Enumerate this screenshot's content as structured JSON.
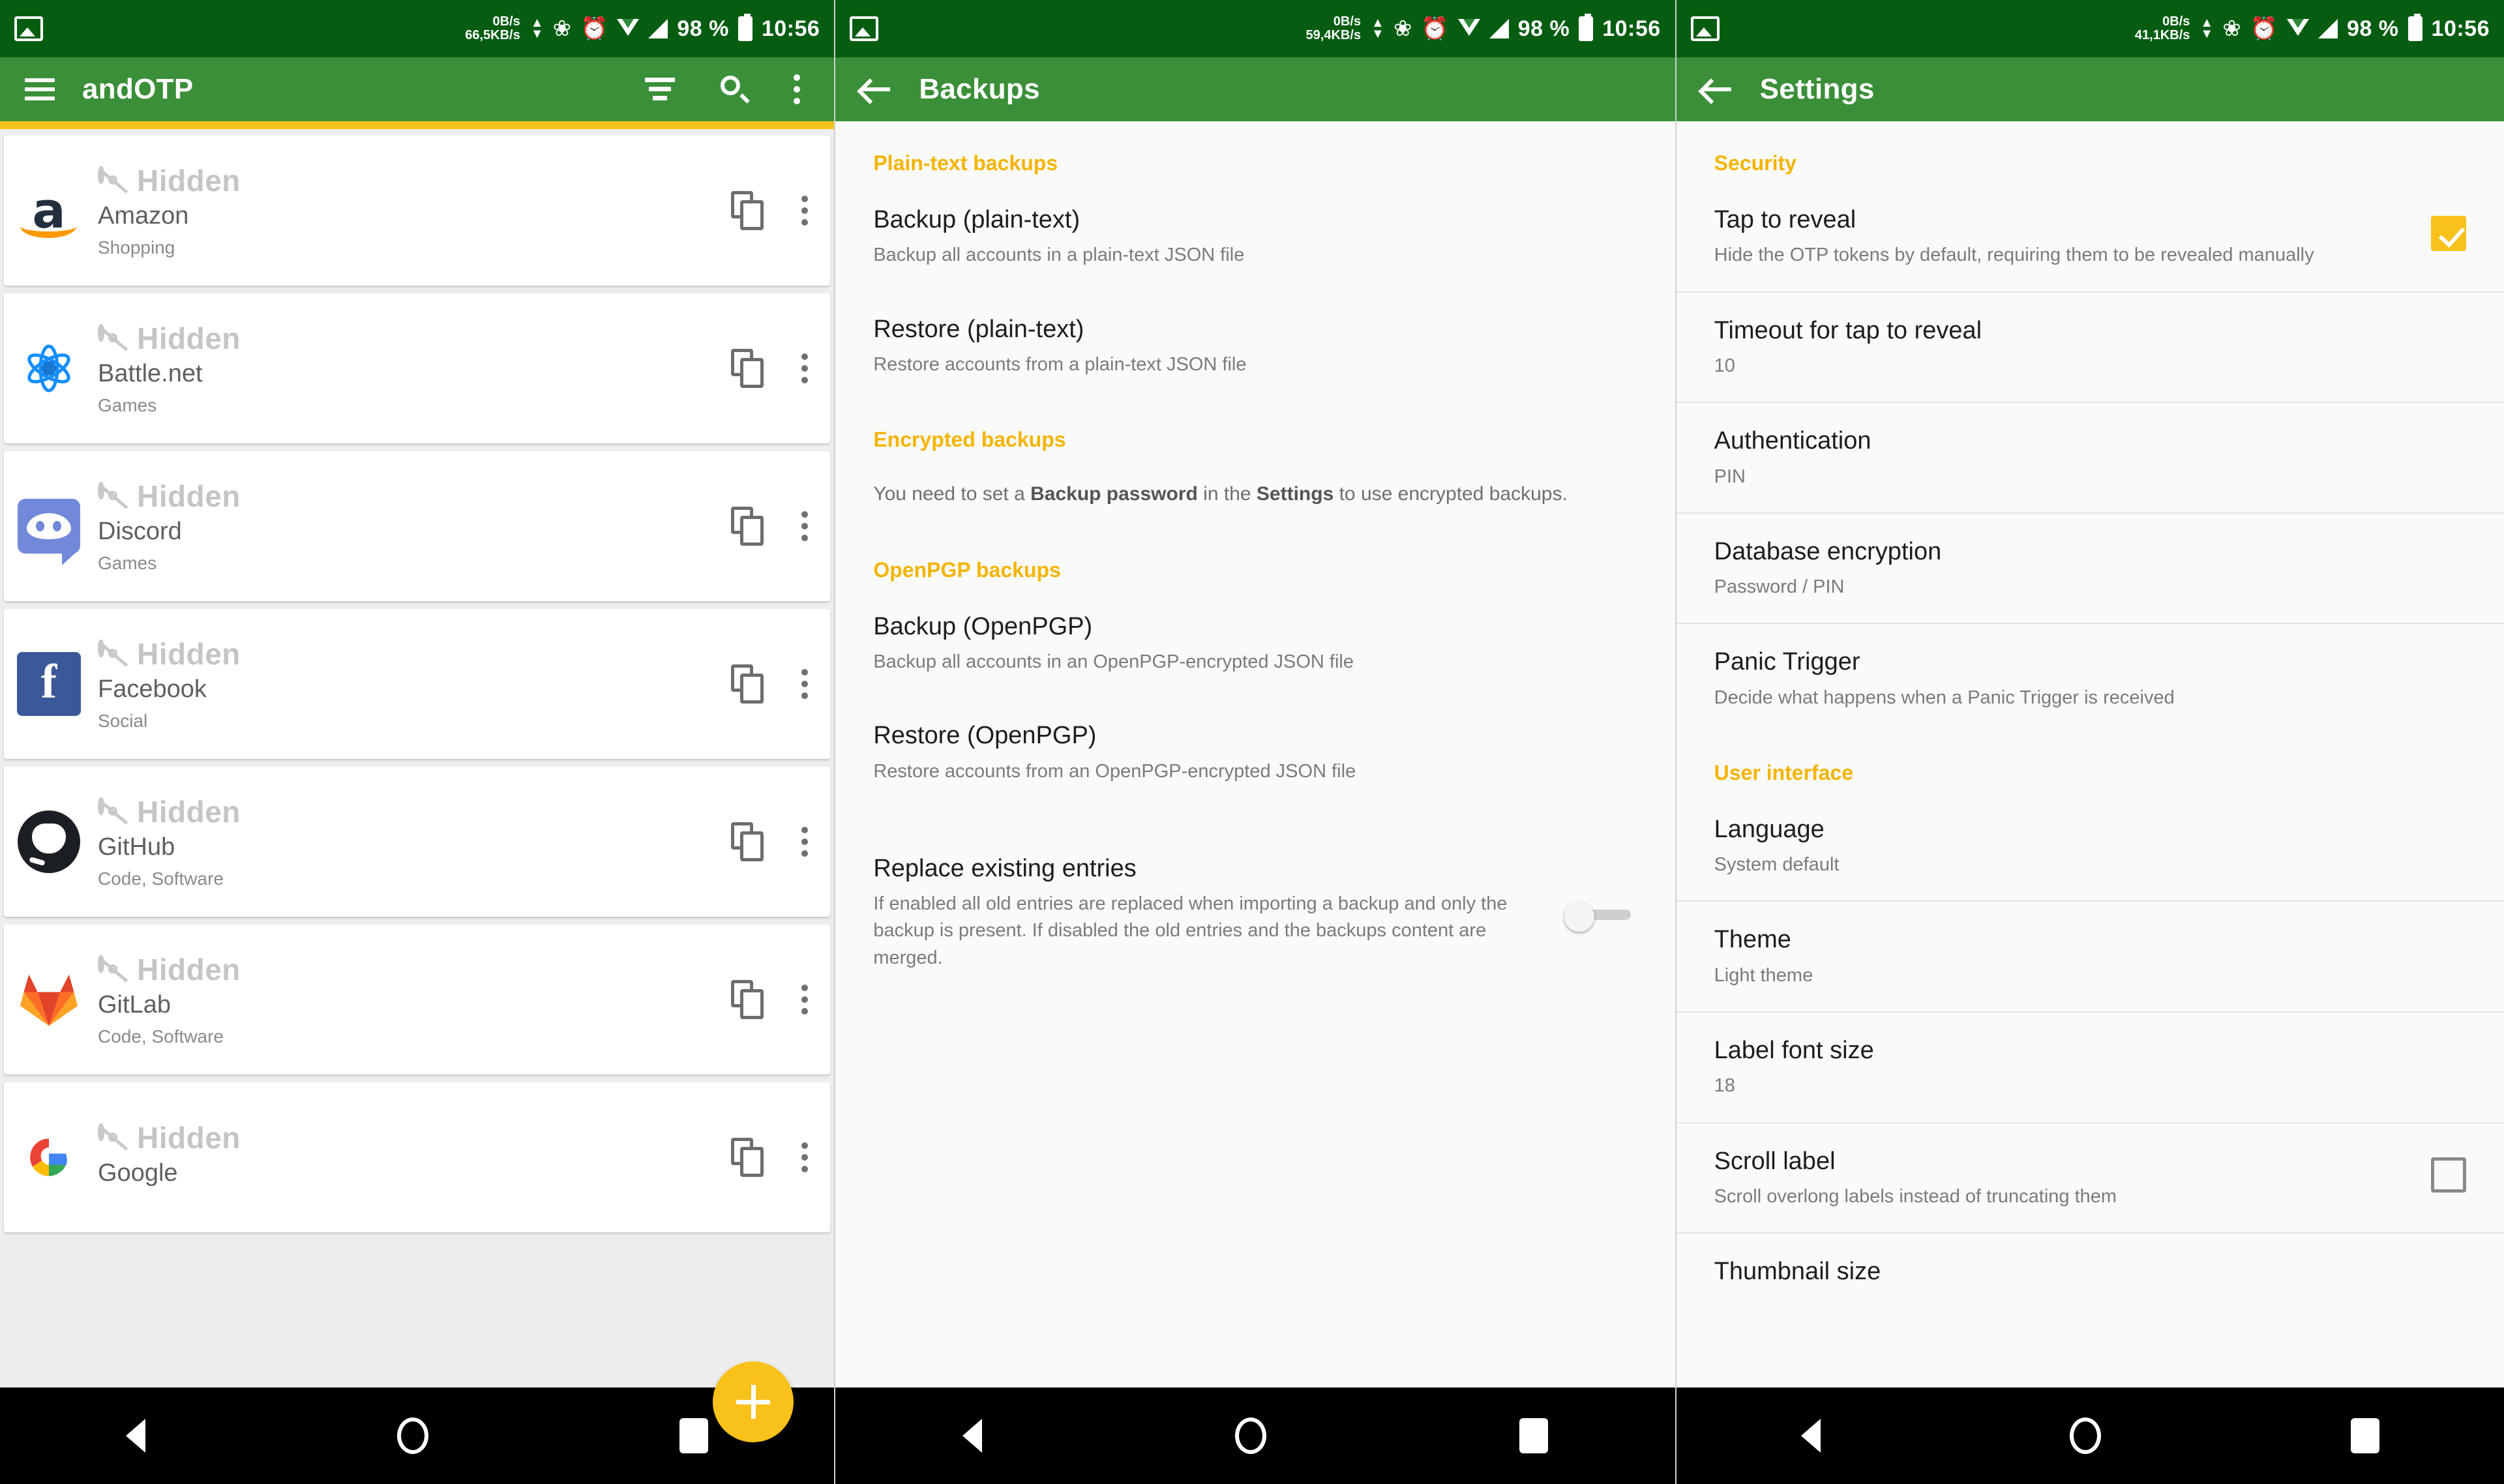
{
  "statusbars": [
    {
      "net_up": "0B/s",
      "net_down": "66,5KB/s",
      "battery": "98 %",
      "time": "10:56"
    },
    {
      "net_up": "0B/s",
      "net_down": "59,4KB/s",
      "battery": "98 %",
      "time": "10:56"
    },
    {
      "net_up": "0B/s",
      "net_down": "41,1KB/s",
      "battery": "98 %",
      "time": "10:56"
    }
  ],
  "screen1": {
    "appbar": {
      "title": "andOTP"
    },
    "hidden_label": "Hidden",
    "accounts": [
      {
        "name": "Amazon",
        "tags": "Shopping",
        "icon": "amazon-logo"
      },
      {
        "name": "Battle.net",
        "tags": "Games",
        "icon": "battlenet-logo"
      },
      {
        "name": "Discord",
        "tags": "Games",
        "icon": "discord-logo"
      },
      {
        "name": "Facebook",
        "tags": "Social",
        "icon": "facebook-logo"
      },
      {
        "name": "GitHub",
        "tags": "Code, Software",
        "icon": "github-logo"
      },
      {
        "name": "GitLab",
        "tags": "Code, Software",
        "icon": "gitlab-logo"
      },
      {
        "name": "Google",
        "tags": "",
        "icon": "google-logo"
      }
    ],
    "fab_label": "+"
  },
  "screen2": {
    "appbar": {
      "title": "Backups"
    },
    "sections": [
      {
        "header": "Plain-text backups",
        "items": [
          {
            "title": "Backup (plain-text)",
            "subtitle": "Backup all accounts in a plain-text JSON file"
          },
          {
            "title": "Restore (plain-text)",
            "subtitle": "Restore accounts from a plain-text JSON file"
          }
        ]
      },
      {
        "header": "Encrypted backups",
        "note_parts": [
          "You need to set a ",
          "Backup password",
          " in the ",
          "Settings",
          " to use encrypted backups."
        ],
        "items": []
      },
      {
        "header": "OpenPGP backups",
        "items": [
          {
            "title": "Backup (OpenPGP)",
            "subtitle": "Backup all accounts in an OpenPGP-encrypted JSON file"
          },
          {
            "title": "Restore (OpenPGP)",
            "subtitle": "Restore accounts from an OpenPGP-encrypted JSON file"
          }
        ]
      }
    ],
    "replace_entries": {
      "title": "Replace existing entries",
      "subtitle": "If enabled all old entries are replaced when importing a backup and only the backup is present. If disabled the old entries and the backups content are merged.",
      "state": "off"
    }
  },
  "screen3": {
    "appbar": {
      "title": "Settings"
    },
    "sections": [
      {
        "header": "Security",
        "items": [
          {
            "title": "Tap to reveal",
            "subtitle": "Hide the OTP tokens by default, requiring them to be revealed manually",
            "control": "checkbox",
            "state": "checked"
          },
          {
            "title": "Timeout for tap to reveal",
            "subtitle": "10",
            "control": "none"
          },
          {
            "title": "Authentication",
            "subtitle": "PIN",
            "control": "none"
          },
          {
            "title": "Database encryption",
            "subtitle": "Password / PIN",
            "control": "none"
          },
          {
            "title": "Panic Trigger",
            "subtitle": "Decide what happens when a Panic Trigger is received",
            "control": "none"
          }
        ]
      },
      {
        "header": "User interface",
        "items": [
          {
            "title": "Language",
            "subtitle": "System default",
            "control": "none"
          },
          {
            "title": "Theme",
            "subtitle": "Light theme",
            "control": "none"
          },
          {
            "title": "Label font size",
            "subtitle": "18",
            "control": "none"
          },
          {
            "title": "Scroll label",
            "subtitle": "Scroll overlong labels instead of truncating them",
            "control": "checkbox",
            "state": "unchecked"
          },
          {
            "title": "Thumbnail size",
            "subtitle": "",
            "control": "none"
          }
        ]
      }
    ]
  },
  "colors": {
    "status_bar": "#065d12",
    "app_bar": "#3a8f38",
    "accent_yellow": "#f9c21b",
    "section_header": "#f4b400"
  }
}
